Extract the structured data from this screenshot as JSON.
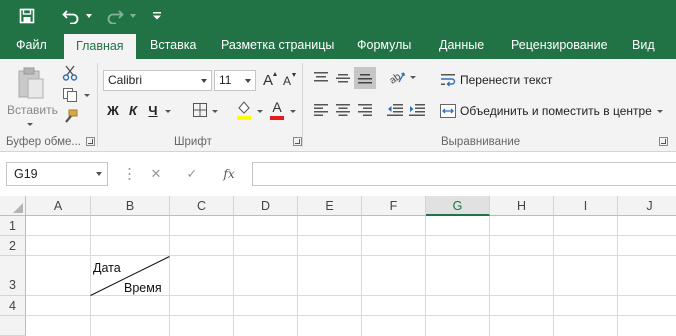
{
  "titlebar": {
    "save_icon": "save-icon",
    "undo_icon": "undo-icon",
    "redo_icon": "redo-icon",
    "customize_icon": "chevron-down-icon"
  },
  "tabs": [
    {
      "label": "Файл"
    },
    {
      "label": "Главная",
      "active": true
    },
    {
      "label": "Вставка"
    },
    {
      "label": "Разметка страницы"
    },
    {
      "label": "Формулы"
    },
    {
      "label": "Данные"
    },
    {
      "label": "Рецензирование"
    },
    {
      "label": "Вид"
    }
  ],
  "ribbon": {
    "clipboard": {
      "paste_label": "Вставить",
      "group_label": "Буфер обме..."
    },
    "font": {
      "font_name": "Calibri",
      "font_size": "11",
      "bold": "Ж",
      "italic": "К",
      "underline": "Ч",
      "grow": "A",
      "shrink": "A",
      "font_color_letter": "A",
      "highlight_color": "#ffff00",
      "font_color": "#e31b1b",
      "group_label": "Шрифт"
    },
    "alignment": {
      "wrap_text": "Перенести текст",
      "merge_center": "Объединить и поместить в центре",
      "group_label": "Выравнивание"
    }
  },
  "formula_bar": {
    "name_box": "G19",
    "cancel": "✕",
    "enter": "✓",
    "fx": "fx",
    "formula": ""
  },
  "grid": {
    "columns": [
      "A",
      "B",
      "C",
      "D",
      "E",
      "F",
      "G",
      "H",
      "I",
      "J"
    ],
    "selected_column": "G",
    "rows": [
      "1",
      "2",
      "3",
      "4"
    ],
    "cell_B3_top": "Дата",
    "cell_B3_bottom": "Время"
  },
  "colors": {
    "accent": "#217346",
    "ribbon_bg": "#f3f3f3"
  }
}
